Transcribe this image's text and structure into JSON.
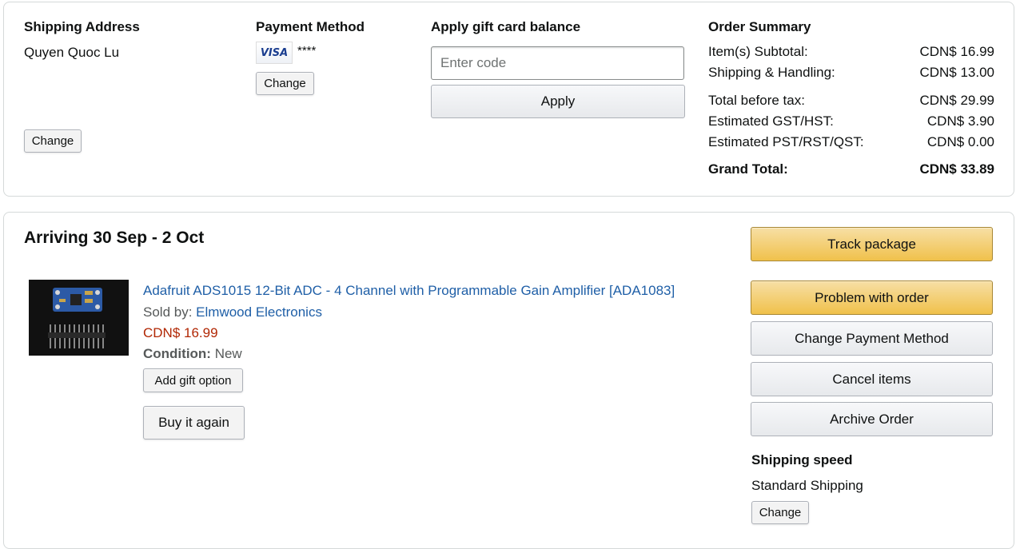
{
  "shipping": {
    "heading": "Shipping Address",
    "name": "Quyen Quoc Lu",
    "change_label": "Change"
  },
  "payment": {
    "heading": "Payment Method",
    "card_brand": "VISA",
    "card_mask": "****",
    "change_label": "Change"
  },
  "gift_card": {
    "heading": "Apply gift card balance",
    "placeholder": "Enter code",
    "apply_label": "Apply"
  },
  "summary": {
    "heading": "Order Summary",
    "rows": [
      {
        "label": "Item(s) Subtotal:",
        "value": "CDN$ 16.99"
      },
      {
        "label": "Shipping & Handling:",
        "value": "CDN$ 13.00"
      },
      {
        "label": "Total before tax:",
        "value": "CDN$ 29.99"
      },
      {
        "label": "Estimated GST/HST:",
        "value": "CDN$ 3.90"
      },
      {
        "label": "Estimated PST/RST/QST:",
        "value": "CDN$ 0.00"
      }
    ],
    "grand_total_label": "Grand Total:",
    "grand_total_value": "CDN$ 33.89"
  },
  "shipment": {
    "arrival": "Arriving 30 Sep - 2 Oct",
    "item": {
      "title": "Adafruit ADS1015 12-Bit ADC - 4 Channel with Programmable Gain Amplifier [ADA1083]",
      "sold_by_label": "Sold by:",
      "seller": "Elmwood Electronics",
      "price": "CDN$ 16.99",
      "condition_label": "Condition:",
      "condition_value": "New",
      "gift_option_label": "Add gift option",
      "buy_again_label": "Buy it again"
    },
    "actions": {
      "track": "Track package",
      "problem": "Problem with order",
      "change_payment": "Change Payment Method",
      "cancel": "Cancel items",
      "archive": "Archive Order"
    },
    "shipping_speed": {
      "heading": "Shipping speed",
      "value": "Standard Shipping",
      "change_label": "Change"
    }
  },
  "colors": {
    "link": "#1f5fa7",
    "price": "#b12704",
    "primary_button": "#f0c14b",
    "border": "#d5d9d9"
  }
}
